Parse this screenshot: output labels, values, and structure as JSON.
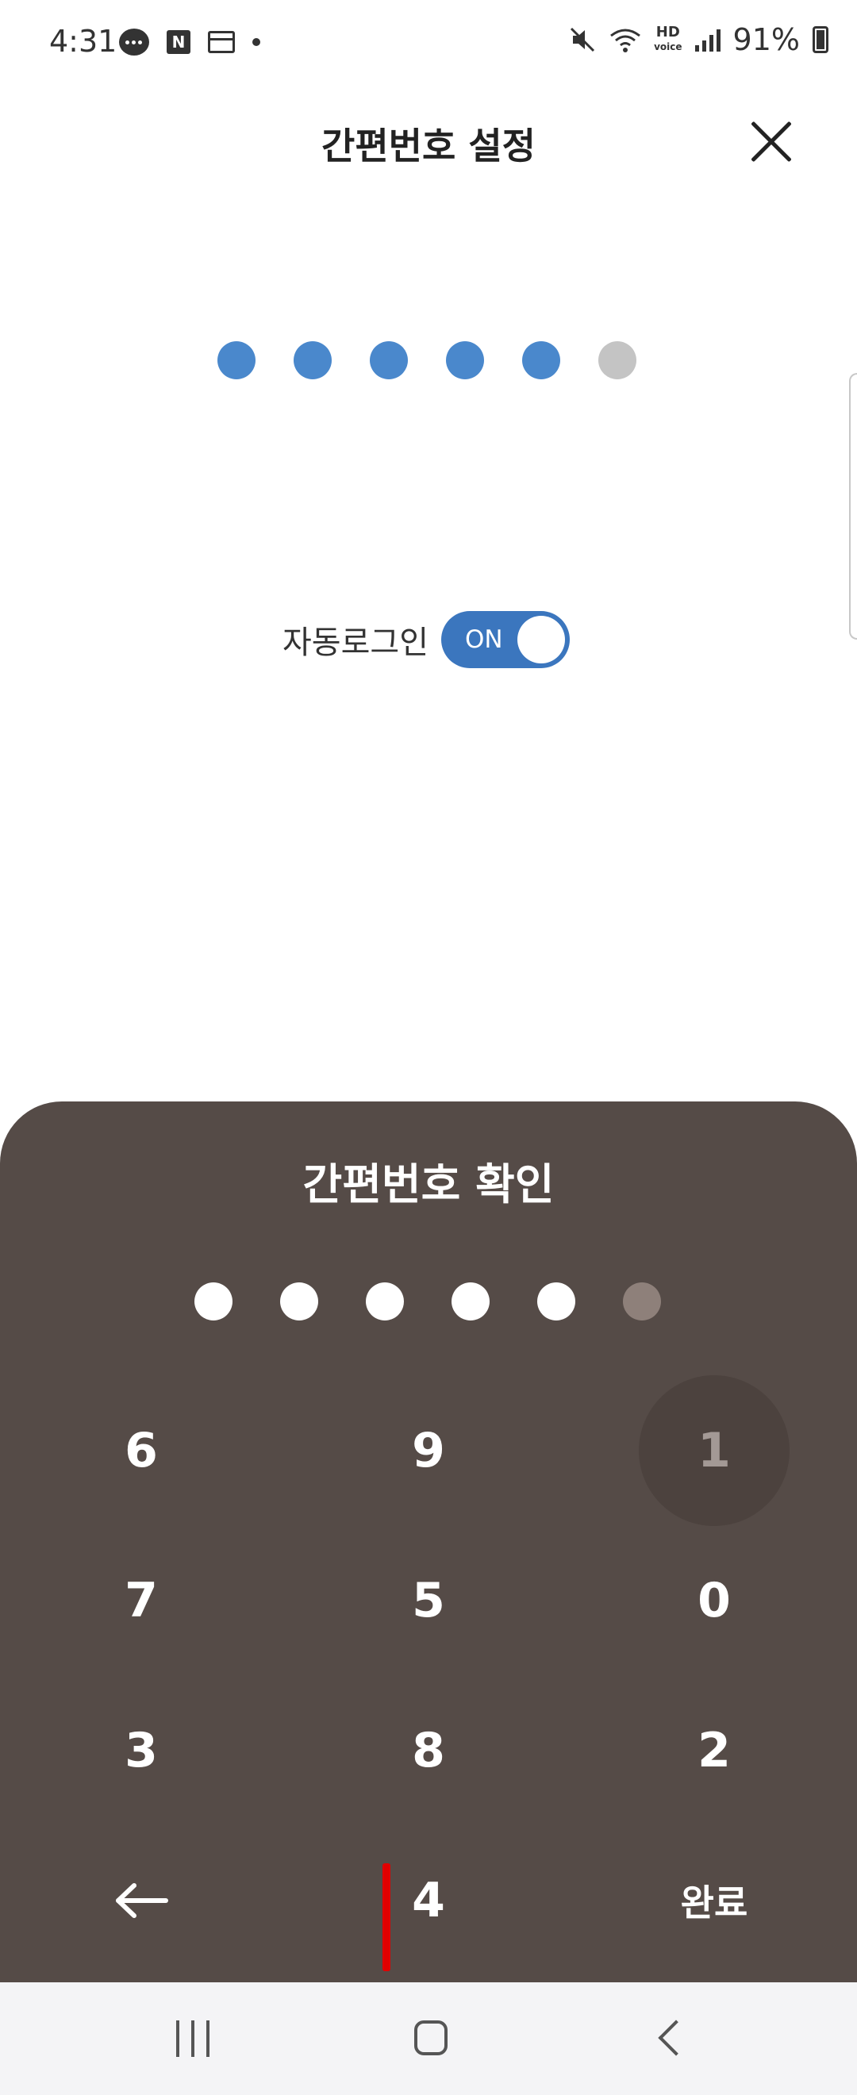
{
  "status_bar": {
    "time": "4:31",
    "hd_label": "HD",
    "voice_label": "voice",
    "battery": "91%"
  },
  "header": {
    "title": "간편번호 설정"
  },
  "pin_entry": {
    "total_digits": 6,
    "filled_digits": 5,
    "filled_color": "#4a88cc",
    "empty_color": "#c4c4c4"
  },
  "auto_login": {
    "label": "자동로그인",
    "toggle_text": "ON",
    "enabled": true,
    "toggle_color": "#3b76be"
  },
  "keypad": {
    "title": "간편번호 확인",
    "filled_digits": 5,
    "total_digits": 6,
    "panel_color": "#554b47",
    "rows": [
      [
        "6",
        "9",
        "1"
      ],
      [
        "7",
        "5",
        "0"
      ],
      [
        "3",
        "8",
        "2"
      ]
    ],
    "backspace_icon": "left-arrow-icon",
    "last_digit": "4",
    "complete_label": "완료",
    "pressed_key": "1"
  },
  "nav_bar": {
    "recent_icon": "recent-apps-icon",
    "home_icon": "home-icon",
    "back_icon": "back-icon"
  }
}
